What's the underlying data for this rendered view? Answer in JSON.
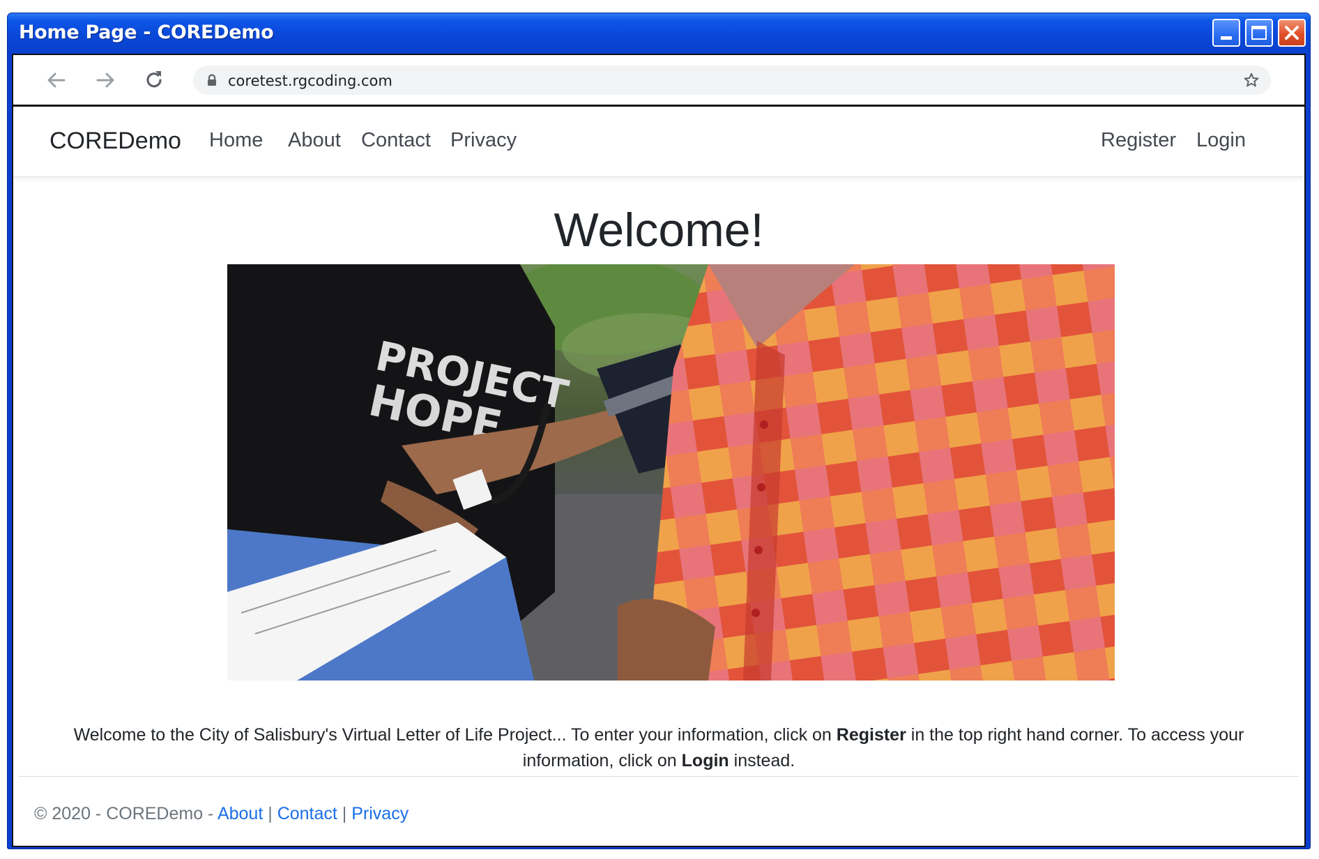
{
  "window": {
    "title": "Home Page - COREDemo"
  },
  "browser": {
    "url": "coretest.rgcoding.com"
  },
  "navbar": {
    "brand": "COREDemo",
    "links": [
      "Home",
      "About",
      "Contact",
      "Privacy"
    ],
    "right_links": [
      "Register",
      "Login"
    ]
  },
  "main": {
    "heading": "Welcome!",
    "intro_part1": "Welcome to the City of Salisbury's Virtual Letter of Life Project... To enter your information, click on ",
    "intro_bold1": "Register",
    "intro_part2": " in the top right hand corner. To access your information, click on ",
    "intro_bold2": "Login",
    "intro_part3": " instead."
  },
  "footer": {
    "copyright": "© 2020 - COREDemo - ",
    "links": [
      "About",
      "Contact",
      "Privacy"
    ],
    "separator": " | "
  },
  "colors": {
    "titlebar": "#0a48d8",
    "link": "#1a6ee8",
    "text": "#212529"
  },
  "icons": [
    "back-arrow-icon",
    "forward-arrow-icon",
    "reload-icon",
    "lock-icon",
    "bookmark-star-icon",
    "minimize-icon",
    "maximize-icon",
    "close-icon"
  ]
}
